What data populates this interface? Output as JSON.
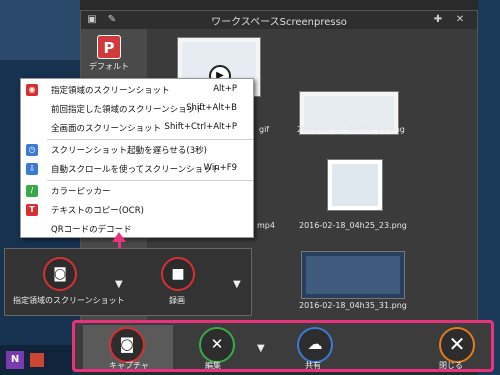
{
  "window": {
    "title": "ワークスペースScreenpresso",
    "sidebar": {
      "default_label": "デフォルト"
    }
  },
  "gallery": {
    "items": [
      {
        "caption": "2016-02-12_00h10_10.png"
      },
      {
        "caption": "2016-02-18_04h25_23.png"
      },
      {
        "caption": "2016-02-18_04h35_31.png"
      }
    ],
    "partial_captions": [
      "gif",
      "mp4",
      "png"
    ]
  },
  "context_menu": {
    "items": [
      {
        "label": "指定領域のスクリーンショット",
        "shortcut": "Alt+P",
        "icon": "region-capture-icon",
        "color": "#d83030"
      },
      {
        "label": "前回指定した領域のスクリーンショット",
        "shortcut": "Shift+Alt+B",
        "icon": "",
        "color": ""
      },
      {
        "label": "全画面のスクリーンショット",
        "shortcut": "Shift+Ctrl+Alt+P",
        "icon": "",
        "color": ""
      },
      {
        "label": "スクリーンショット起動を遅らせる(3秒)",
        "shortcut": "",
        "icon": "timer-icon",
        "color": "#3a7bd5"
      },
      {
        "label": "自動スクロールを使ってスクリーンショット",
        "shortcut": "Win+F9",
        "icon": "scroll-capture-icon",
        "color": "#3a7bd5"
      },
      {
        "label": "カラーピッカー",
        "shortcut": "",
        "icon": "color-picker-icon",
        "color": "#3aa84a"
      },
      {
        "label": "テキストのコピー(OCR)",
        "shortcut": "",
        "icon": "text-ocr-icon",
        "color": "#d83030"
      },
      {
        "label": "QRコードのデコード",
        "shortcut": "",
        "icon": "",
        "color": ""
      }
    ]
  },
  "capture_panel": {
    "region_label": "指定領域のスクリーンショット",
    "record_label": "録画"
  },
  "toolbar": {
    "capture_label": "キャプチャ",
    "edit_label": "編集",
    "share_label": "共有",
    "close_label": "閉じる"
  },
  "colors": {
    "accent_pink": "#e8337a",
    "red": "#d83030",
    "green": "#3aa84a",
    "blue": "#3a7bd5",
    "orange": "#e07b20"
  }
}
